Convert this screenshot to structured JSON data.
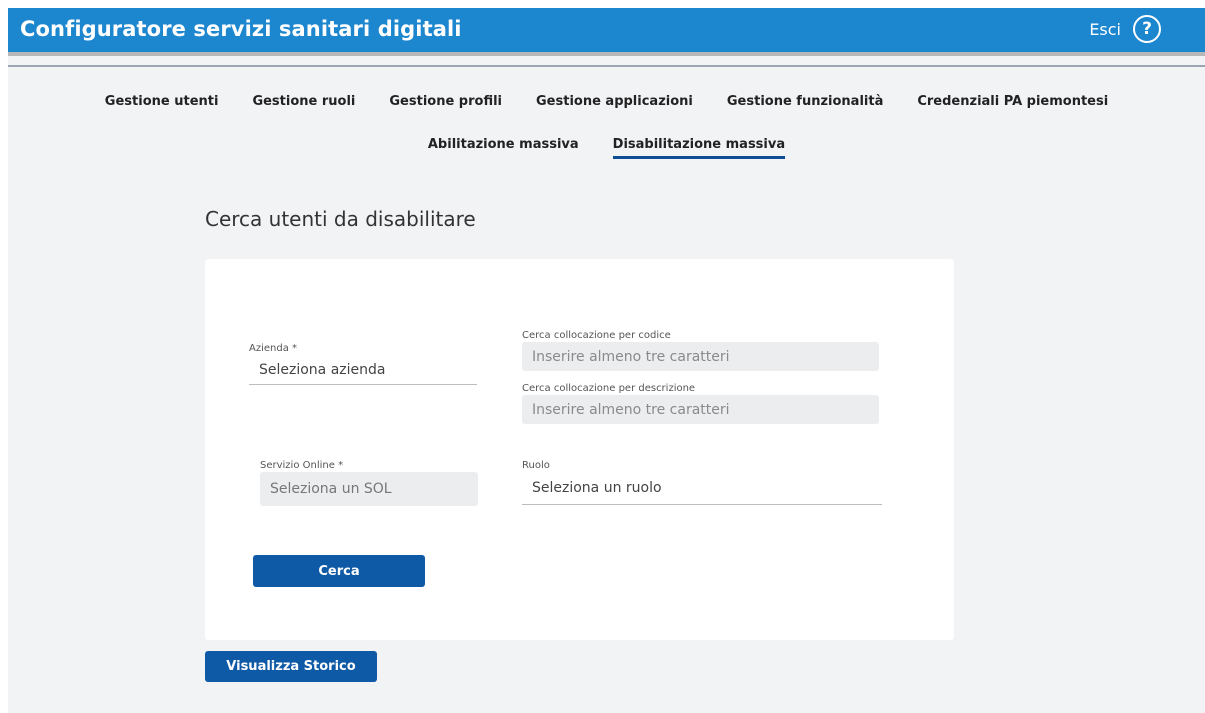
{
  "header": {
    "title": "Configuratore servizi sanitari digitali",
    "logout_label": "Esci",
    "help_glyph": "?",
    "background_color": "#1c86cf"
  },
  "nav": {
    "row1": [
      {
        "label": "Gestione utenti"
      },
      {
        "label": "Gestione ruoli"
      },
      {
        "label": "Gestione profili"
      },
      {
        "label": "Gestione applicazioni"
      },
      {
        "label": "Gestione funzionalità"
      },
      {
        "label": "Credenziali PA piemontesi"
      }
    ],
    "row2": [
      {
        "label": "Abilitazione massiva"
      },
      {
        "label": "Disabilitazione massiva",
        "active": true
      }
    ],
    "active_color": "#0e4c94"
  },
  "page": {
    "title": "Cerca utenti da disabilitare"
  },
  "form": {
    "azienda": {
      "label": "Azienda *",
      "value": "Seleziona azienda"
    },
    "codice": {
      "label": "Cerca collocazione per codice",
      "placeholder": "Inserire almeno tre caratteri"
    },
    "descrizione": {
      "label": "Cerca collocazione per descrizione",
      "placeholder": "Inserire almeno tre caratteri"
    },
    "servizio": {
      "label": "Servizio Online *",
      "value": "Seleziona un SOL"
    },
    "ruolo": {
      "label": "Ruolo",
      "value": "Seleziona un ruolo"
    },
    "search_button": "Cerca"
  },
  "history_button": "Visualizza Storico",
  "colors": {
    "primary_button": "#0f5aa6",
    "page_background": "#f2f3f5"
  }
}
